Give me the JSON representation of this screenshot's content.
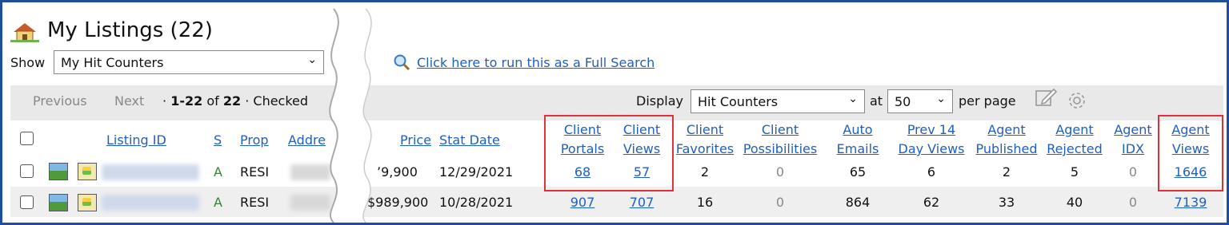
{
  "header": {
    "title": "My Listings (22)",
    "house_icon": "house-icon"
  },
  "show": {
    "label": "Show",
    "value": "My Hit Counters"
  },
  "search_link": "Click here to run this as a Full Search",
  "pager": {
    "previous": "Previous",
    "next": "Next",
    "range_prefix": "·",
    "range": "1-22",
    "of": "of",
    "total": "22",
    "sep": "·",
    "checked": "Checked"
  },
  "display": {
    "label": "Display",
    "value": "Hit Counters",
    "at": "at",
    "per_page_value": "50",
    "per_page": "per page"
  },
  "columns_left": {
    "listing_id": "Listing ID",
    "s": "S",
    "prop": "Prop",
    "addr": "Addre"
  },
  "columns_right": {
    "price": "Price",
    "stat_date": "Stat Date",
    "client_portals_1": "Client",
    "client_portals_2": "Portals",
    "client_views_1": "Client",
    "client_views_2": "Views",
    "client_favorites_1": "Client",
    "client_favorites_2": "Favorites",
    "client_possibilities_1": "Client",
    "client_possibilities_2": "Possibilities",
    "auto_emails_1": "Auto",
    "auto_emails_2": "Emails",
    "prev14_1": "Prev 14",
    "prev14_2": "Day Views",
    "agent_published_1": "Agent",
    "agent_published_2": "Published",
    "agent_rejected_1": "Agent",
    "agent_rejected_2": "Rejected",
    "agent_idx_1": "Agent",
    "agent_idx_2": "IDX",
    "agent_views_1": "Agent",
    "agent_views_2": "Views"
  },
  "rows": [
    {
      "status": "A",
      "prop": "RESI",
      "price": "’9,900",
      "stat_date": "12/29/2021",
      "client_portals": "68",
      "client_views": "57",
      "client_favorites": "2",
      "client_possibilities": "0",
      "auto_emails": "65",
      "prev14": "6",
      "agent_published": "2",
      "agent_rejected": "5",
      "agent_idx": "0",
      "agent_views": "1646"
    },
    {
      "status": "A",
      "prop": "RESI",
      "price": "$989,900",
      "stat_date": "10/28/2021",
      "client_portals": "907",
      "client_views": "707",
      "client_favorites": "16",
      "client_possibilities": "0",
      "auto_emails": "864",
      "prev14": "62",
      "agent_published": "33",
      "agent_rejected": "40",
      "agent_idx": "0",
      "agent_views": "7139"
    }
  ]
}
